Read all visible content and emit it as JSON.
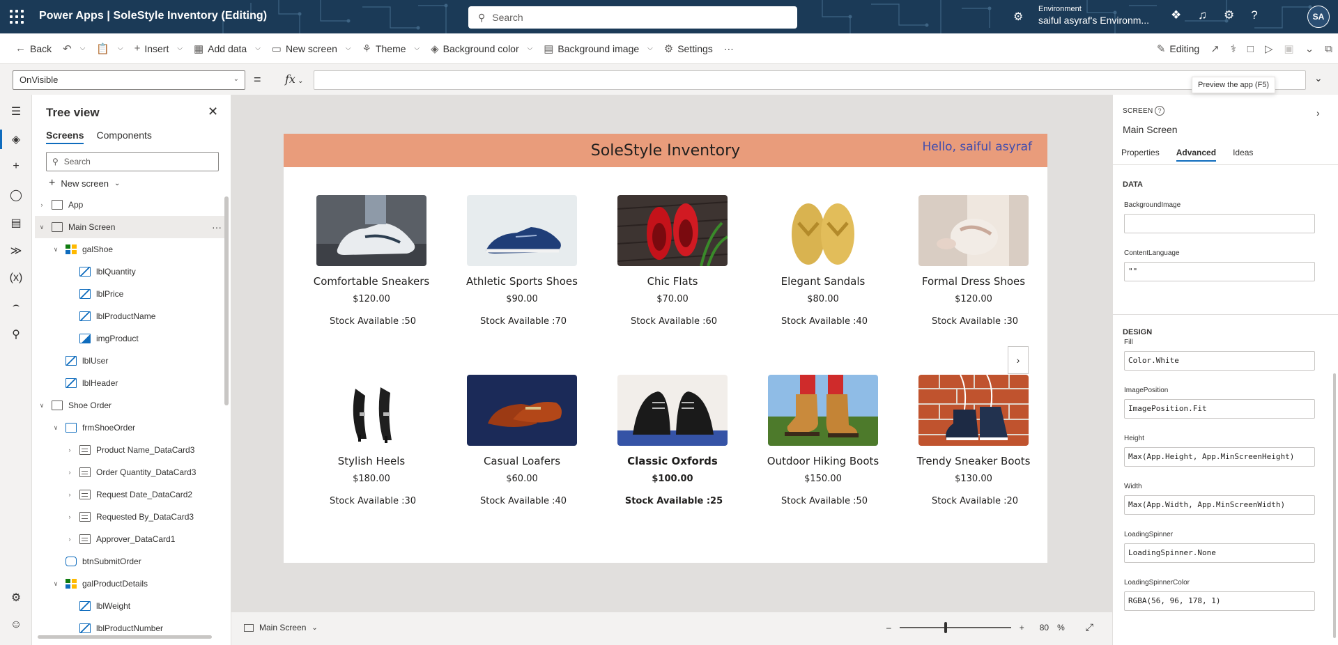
{
  "titlebar": {
    "title": "Power Apps  |  SoleStyle Inventory (Editing)",
    "search_placeholder": "Search",
    "env_label": "Environment",
    "env_name": "saiful asyraf's Environm...",
    "avatar": "SA",
    "icons": [
      "copilot-icon",
      "bell-icon",
      "gear-icon",
      "help-icon"
    ]
  },
  "commandbar": {
    "back": "Back",
    "insert": "Insert",
    "add_data": "Add data",
    "new_screen": "New screen",
    "theme": "Theme",
    "background_color": "Background color",
    "background_image": "Background image",
    "settings": "Settings",
    "more": "···",
    "editing": "Editing",
    "tooltip": "Preview the app (F5)"
  },
  "formulabar": {
    "property": "OnVisible",
    "equals": "=",
    "fx": "fx",
    "formula": ""
  },
  "tree": {
    "title": "Tree view",
    "tabs": [
      "Screens",
      "Components"
    ],
    "search_placeholder": "Search",
    "new_screen": "New screen",
    "nodes": [
      {
        "label": "App",
        "depth": 0,
        "icon": "screen",
        "expander": ">"
      },
      {
        "label": "Main Screen",
        "depth": 0,
        "icon": "screen",
        "expander": "v",
        "selected": true
      },
      {
        "label": "galShoe",
        "depth": 1,
        "icon": "gallery",
        "expander": "v"
      },
      {
        "label": "lblQuantity",
        "depth": 2,
        "icon": "label"
      },
      {
        "label": "lblPrice",
        "depth": 2,
        "icon": "label"
      },
      {
        "label": "lblProductName",
        "depth": 2,
        "icon": "label"
      },
      {
        "label": "imgProduct",
        "depth": 2,
        "icon": "image"
      },
      {
        "label": "lblUser",
        "depth": 1,
        "icon": "label"
      },
      {
        "label": "lblHeader",
        "depth": 1,
        "icon": "label"
      },
      {
        "label": "Shoe Order",
        "depth": 0,
        "icon": "screen",
        "expander": "v"
      },
      {
        "label": "frmShoeOrder",
        "depth": 1,
        "icon": "form",
        "expander": "v"
      },
      {
        "label": "Product Name_DataCard3",
        "depth": 2,
        "icon": "card",
        "expander": ">"
      },
      {
        "label": "Order Quantity_DataCard3",
        "depth": 2,
        "icon": "card",
        "expander": ">"
      },
      {
        "label": "Request Date_DataCard2",
        "depth": 2,
        "icon": "card",
        "expander": ">"
      },
      {
        "label": "Requested By_DataCard3",
        "depth": 2,
        "icon": "card",
        "expander": ">"
      },
      {
        "label": "Approver_DataCard1",
        "depth": 2,
        "icon": "card",
        "expander": ">"
      },
      {
        "label": "btnSubmitOrder",
        "depth": 1,
        "icon": "button"
      },
      {
        "label": "galProductDetails",
        "depth": 1,
        "icon": "gallery",
        "expander": "v"
      },
      {
        "label": "lblWeight",
        "depth": 2,
        "icon": "label"
      },
      {
        "label": "lblProductNumber",
        "depth": 2,
        "icon": "label"
      }
    ]
  },
  "app": {
    "header_title": "SoleStyle Inventory",
    "user_greeting": "Hello, saiful asyraf",
    "products": [
      {
        "name": "Comfortable Sneakers",
        "price": "$120.00",
        "stock": "Stock Available :50",
        "image": "sneaker-photo"
      },
      {
        "name": "Athletic Sports Shoes",
        "price": "$90.00",
        "stock": "Stock Available :70",
        "image": "sports-shoe-photo"
      },
      {
        "name": "Chic Flats",
        "price": "$70.00",
        "stock": "Stock Available :60",
        "image": "red-flats-photo"
      },
      {
        "name": "Elegant Sandals",
        "price": "$80.00",
        "stock": "Stock Available :40",
        "image": "gold-sandals-photo"
      },
      {
        "name": "Formal Dress Shoes",
        "price": "$120.00",
        "stock": "Stock Available :30",
        "image": "dress-shoe-photo"
      },
      {
        "name": "Stylish Heels",
        "price": "$180.00",
        "stock": "Stock Available :30",
        "image": "heels-photo"
      },
      {
        "name": "Casual Loafers",
        "price": "$60.00",
        "stock": "Stock Available :40",
        "image": "loafers-photo"
      },
      {
        "name": "Classic Oxfords",
        "price": "$100.00",
        "stock": "Stock Available :25",
        "image": "oxfords-photo",
        "bold": true
      },
      {
        "name": "Outdoor Hiking Boots",
        "price": "$150.00",
        "stock": "Stock Available :50",
        "image": "hiking-boots-photo"
      },
      {
        "name": "Trendy Sneaker Boots",
        "price": "$130.00",
        "stock": "Stock Available :20",
        "image": "sneaker-boots-photo"
      }
    ]
  },
  "status": {
    "screen": "Main Screen",
    "zoom_percent": 80,
    "zoom_label": "80",
    "percent_sign": "%"
  },
  "properties": {
    "kind": "SCREEN",
    "screen_name": "Main Screen",
    "tabs": [
      "Properties",
      "Advanced",
      "Ideas"
    ],
    "active_tab": "Advanced",
    "data_section": "DATA",
    "design_section": "DESIGN",
    "fields": [
      {
        "label": "BackgroundImage",
        "value": ""
      },
      {
        "label": "ContentLanguage",
        "value": "\"\""
      },
      {
        "label": "Fill",
        "value": "Color.White"
      },
      {
        "label": "ImagePosition",
        "value": "ImagePosition.Fit"
      },
      {
        "label": "Height",
        "value": "Max(App.Height, App.MinScreenHeight)"
      },
      {
        "label": "Width",
        "value": "Max(App.Width, App.MinScreenWidth)"
      },
      {
        "label": "LoadingSpinner",
        "value": "LoadingSpinner.None"
      },
      {
        "label": "LoadingSpinnerColor",
        "value": "RGBA(56, 96, 178, 1)"
      }
    ]
  },
  "colors": {
    "header": "#e99c7b",
    "greeting": "#3f4cae",
    "accent": "#0f6cbd"
  }
}
